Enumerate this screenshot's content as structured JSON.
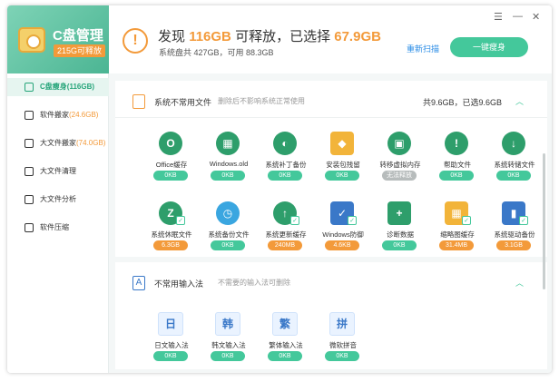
{
  "app": {
    "title": "C盘管理",
    "badge": "215G可释放",
    "controls": [
      "☰",
      "—",
      "✕"
    ]
  },
  "sidebar": {
    "items": [
      {
        "label": "C盘瘦身",
        "extra": "(116GB)",
        "active": true
      },
      {
        "label": "软件搬家",
        "extra": "(24.6GB)",
        "active": false
      },
      {
        "label": "大文件搬家",
        "extra": "(74.0GB)",
        "active": false
      },
      {
        "label": "大文件清理",
        "extra": "",
        "active": false
      },
      {
        "label": "大文件分析",
        "extra": "",
        "active": false
      },
      {
        "label": "软件压缩",
        "extra": "",
        "active": false
      }
    ]
  },
  "header": {
    "headline_1": "发现",
    "found_size": "116GB",
    "headline_2": "可释放，已选择",
    "selected_size": "67.9GB",
    "subline": "系统盘共 427GB，可用 88.3GB",
    "rescan": "重新扫描",
    "slim_button": "一键瘦身"
  },
  "section1": {
    "title": "系统不常用文件",
    "desc": "删除后不影响系统正常使用",
    "summary": "共9.6GB，已选9.6GB",
    "toggle": "︿",
    "items": [
      {
        "label": "Office缓存",
        "size": "0KB",
        "color": "#2e9e6b",
        "glyph": "O",
        "badge": "green",
        "checked": false
      },
      {
        "label": "Windows.old",
        "size": "0KB",
        "color": "#2e9e6b",
        "glyph": "▦",
        "badge": "green",
        "checked": false
      },
      {
        "label": "系统补丁备份",
        "size": "0KB",
        "color": "#2e9e6b",
        "glyph": "◐",
        "badge": "green",
        "checked": false
      },
      {
        "label": "安装包残留",
        "size": "0KB",
        "color": "#f2b43a",
        "glyph": "◆",
        "badge": "green",
        "checked": false,
        "square": true
      },
      {
        "label": "转移虚拟内存",
        "size": "无法释放",
        "color": "#2e9e6b",
        "glyph": "▣",
        "badge": "gray",
        "checked": false
      },
      {
        "label": "帮助文件",
        "size": "0KB",
        "color": "#2e9e6b",
        "glyph": "!",
        "badge": "green",
        "checked": false
      },
      {
        "label": "系统转储文件",
        "size": "0KB",
        "color": "#2e9e6b",
        "glyph": "↓",
        "badge": "green",
        "checked": false
      },
      {
        "label": "系统休眠文件",
        "size": "6.3GB",
        "color": "#2e9e6b",
        "glyph": "Z",
        "badge": "orange",
        "checked": true
      },
      {
        "label": "系统备份文件",
        "size": "0KB",
        "color": "#3aa6e0",
        "glyph": "◷",
        "badge": "green",
        "checked": false
      },
      {
        "label": "系统更新缓存",
        "size": "240MB",
        "color": "#2e9e6b",
        "glyph": "↑",
        "badge": "orange",
        "checked": true
      },
      {
        "label": "Windows防御",
        "size": "4.6KB",
        "color": "#3a78c8",
        "glyph": "✓",
        "badge": "orange",
        "checked": true,
        "square": true
      },
      {
        "label": "诊断数据",
        "size": "0KB",
        "color": "#2e9e6b",
        "glyph": "+",
        "badge": "green",
        "checked": false,
        "square": true
      },
      {
        "label": "缩略图缓存",
        "size": "31.4MB",
        "color": "#f2b43a",
        "glyph": "▦",
        "badge": "orange",
        "checked": true,
        "square": true
      },
      {
        "label": "系统驱动备份",
        "size": "3.1GB",
        "color": "#3a78c8",
        "glyph": "▮",
        "badge": "orange",
        "checked": true,
        "square": true
      }
    ]
  },
  "section2": {
    "title": "不常用输入法",
    "desc": "不需要的输入法可删除",
    "toggle": "︿",
    "items": [
      {
        "label": "日文输入法",
        "size": "0KB",
        "glyph": "日"
      },
      {
        "label": "韩文输入法",
        "size": "0KB",
        "glyph": "韩"
      },
      {
        "label": "繁体输入法",
        "size": "0KB",
        "glyph": "繁"
      },
      {
        "label": "微软拼音",
        "size": "0KB",
        "glyph": "拼"
      }
    ]
  }
}
